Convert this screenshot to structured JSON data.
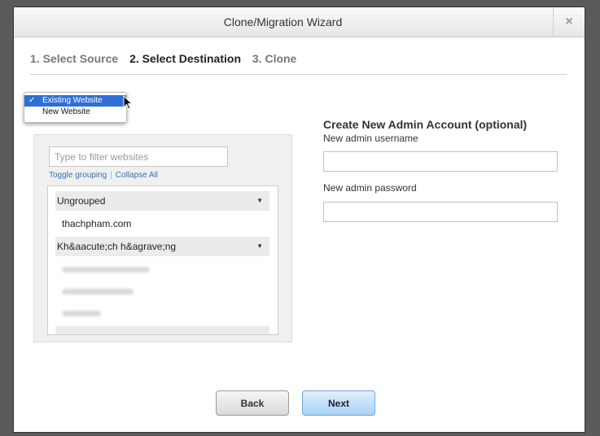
{
  "window": {
    "title": "Clone/Migration Wizard",
    "close_glyph": "×"
  },
  "steps": [
    {
      "label": "1. Select Source",
      "active": false
    },
    {
      "label": "2. Select Destination",
      "active": true
    },
    {
      "label": "3. Clone",
      "active": false
    }
  ],
  "destination_dropdown": {
    "options": [
      "Existing Website",
      "New Website"
    ],
    "selected": "Existing Website",
    "check_glyph": "✓"
  },
  "website_picker": {
    "filter_placeholder": "Type to filter websites",
    "toggle_grouping": "Toggle grouping",
    "link_separator": "|",
    "collapse_all": "Collapse All",
    "groups": [
      {
        "name": "Ungrouped",
        "items": [
          "thachpham.com"
        ]
      },
      {
        "name": "Kh&aacute;ch h&agrave;ng",
        "items": []
      }
    ]
  },
  "admin_account": {
    "title": "Create New Admin Account (optional)",
    "username_label": "New admin username",
    "username_value": "",
    "password_label": "New admin password",
    "password_value": ""
  },
  "buttons": {
    "back": "Back",
    "next": "Next"
  },
  "colors": {
    "selection": "#2f6fd6",
    "link": "#3b6fb6",
    "next_button": "#a9d3f5"
  }
}
